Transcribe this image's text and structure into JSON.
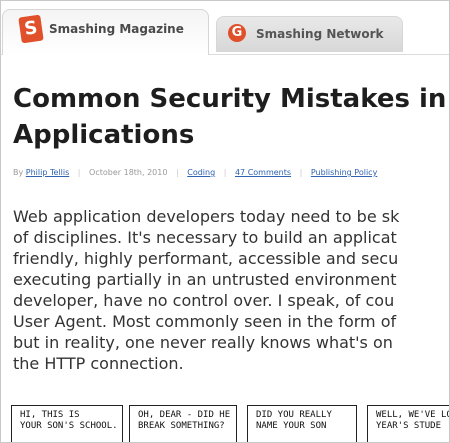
{
  "tabs": [
    {
      "label": "Smashing Magazine",
      "icon": "smashing-s-logo-icon",
      "active": true
    },
    {
      "label": "Smashing Network",
      "icon": "smashing-network-logo-icon",
      "active": false
    }
  ],
  "article": {
    "title_lines": [
      "Common Security Mistakes in W",
      "Applications"
    ],
    "meta": {
      "by": "By",
      "author": "Philip Tellis",
      "date": "October 18th, 2010",
      "category": "Coding",
      "comments": "47 Comments",
      "policy": "Publishing Policy"
    },
    "body_lines": [
      "Web application developers today need to be sk",
      "of disciplines. It's necessary to build an applicat",
      "friendly, highly performant, accessible and secu",
      "executing partially in an untrusted environment",
      "developer, have no control over. I speak, of cou",
      "User Agent. Most commonly seen in the form of",
      "but in reality, one never really knows what's on",
      "the HTTP connection."
    ]
  },
  "comic": {
    "panels": [
      {
        "lines": [
          "HI, THIS IS",
          "YOUR SON'S SCHOOL."
        ]
      },
      {
        "lines": [
          "OH, DEAR - DID HE",
          "BREAK SOMETHING?"
        ]
      },
      {
        "lines": [
          "DID YOU REALLY",
          "NAME YOUR SON"
        ]
      },
      {
        "lines": [
          "WELL, WE'VE LO",
          "YEAR'S STUDE"
        ]
      }
    ]
  },
  "colors": {
    "accent": "#e0502a",
    "link": "#2f62b0"
  }
}
